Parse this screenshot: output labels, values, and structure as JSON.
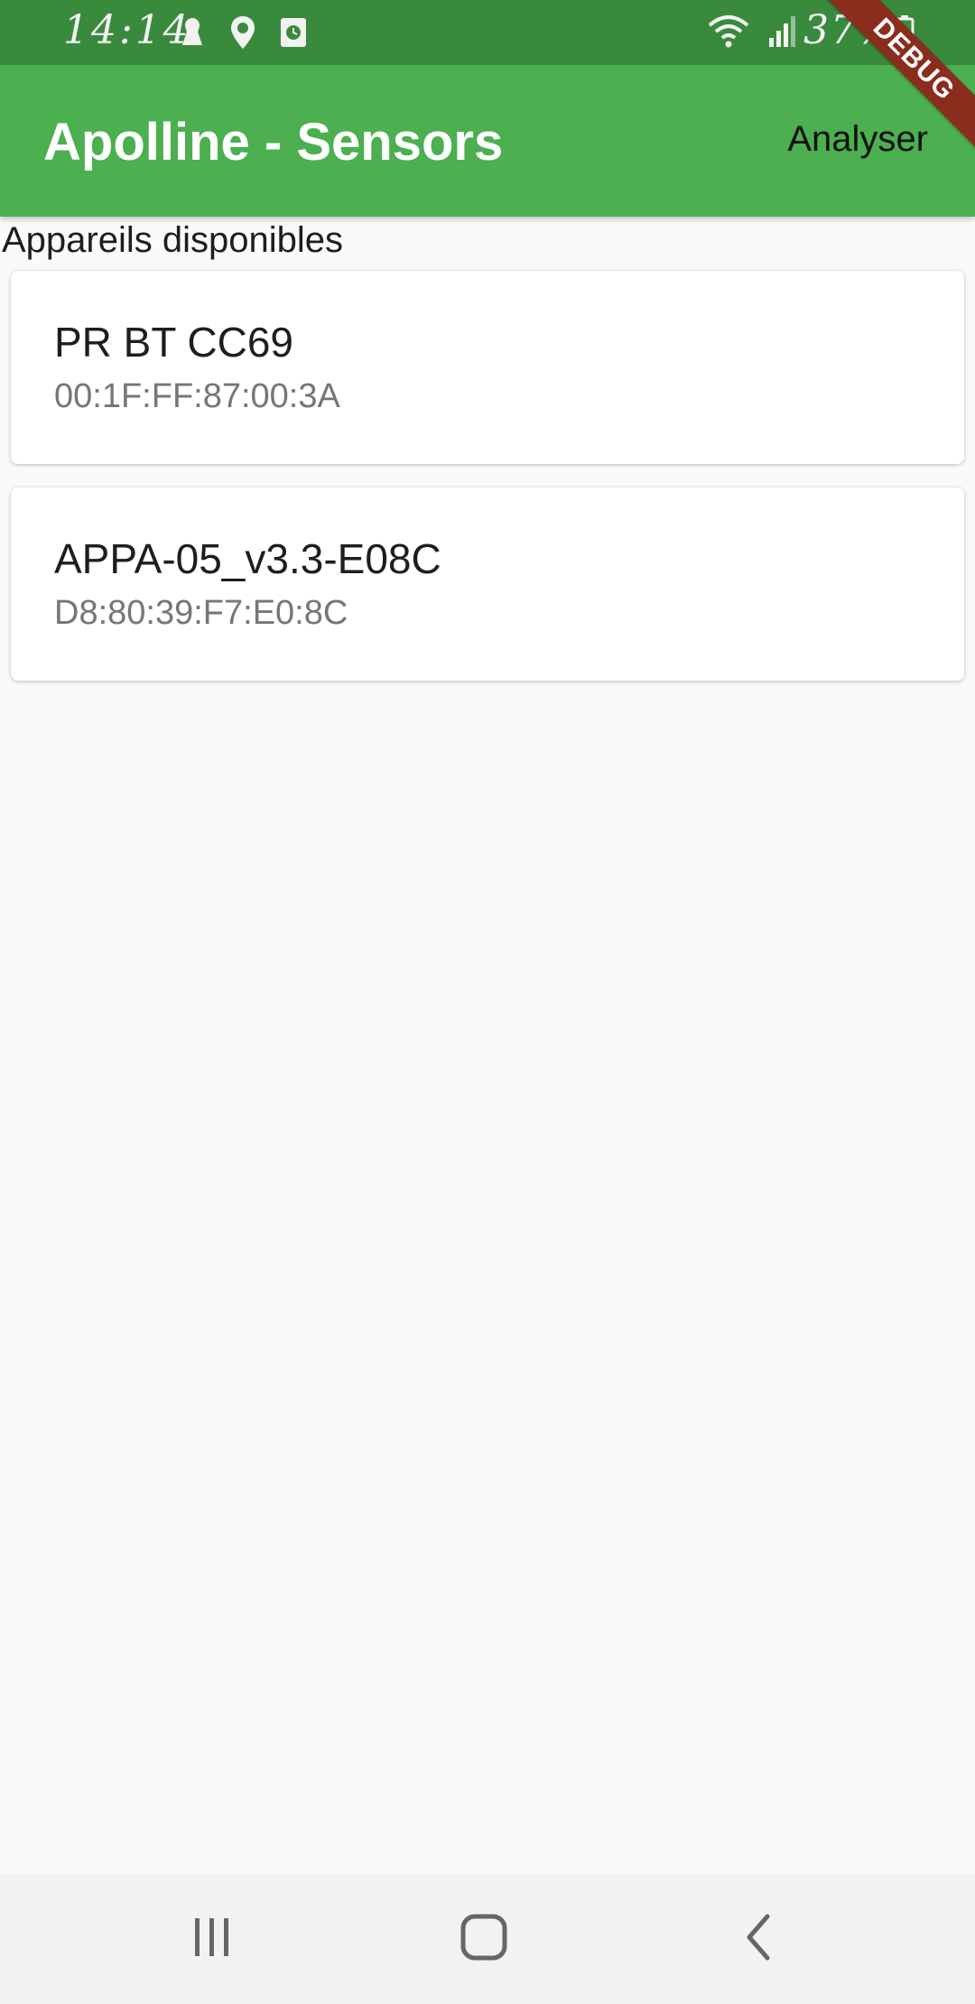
{
  "status_bar": {
    "time": "14:14",
    "battery": "37%",
    "left_icons": [
      "notification-icon",
      "location-icon",
      "clock-app-icon"
    ],
    "right_icons": [
      "wifi-icon",
      "signal-icon",
      "battery-icon"
    ]
  },
  "app_bar": {
    "title": "Apolline - Sensors",
    "action_label": "Analyser",
    "color": "#4caf50"
  },
  "debug_banner": {
    "label": "DEBUG",
    "color": "#8b2d1c"
  },
  "content": {
    "section_label": "Appareils disponibles",
    "devices": [
      {
        "name": "PR BT CC69",
        "address": "00:1F:FF:87:00:3A"
      },
      {
        "name": "APPA-05_v3.3-E08C",
        "address": "D8:80:39:F7:E0:8C"
      }
    ]
  },
  "nav_bar": {
    "buttons": [
      "recent-apps-icon",
      "home-icon",
      "back-icon"
    ]
  }
}
